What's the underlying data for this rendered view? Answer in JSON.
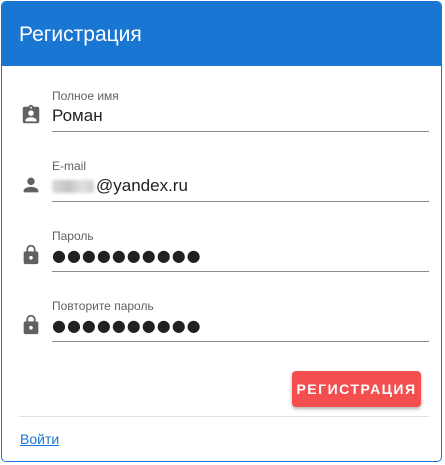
{
  "header": {
    "title": "Регистрация"
  },
  "form": {
    "fullname": {
      "label": "Полное имя",
      "value": "Роман",
      "icon": "contact-badge-icon"
    },
    "email": {
      "label": "E-mail",
      "value_visible": "@yandex.ru",
      "icon": "person-icon"
    },
    "password": {
      "label": "Пароль",
      "value": "●●●●●●●●●●",
      "icon": "lock-icon"
    },
    "password_repeat": {
      "label": "Повторите пароль",
      "value": "●●●●●●●●●●",
      "icon": "lock-icon"
    }
  },
  "actions": {
    "register_label": "РЕГИСТРАЦИЯ",
    "login_link": "Войти"
  },
  "colors": {
    "header_bg": "#1976d2",
    "button_bg": "#f44e4e",
    "link": "#1976d2"
  }
}
